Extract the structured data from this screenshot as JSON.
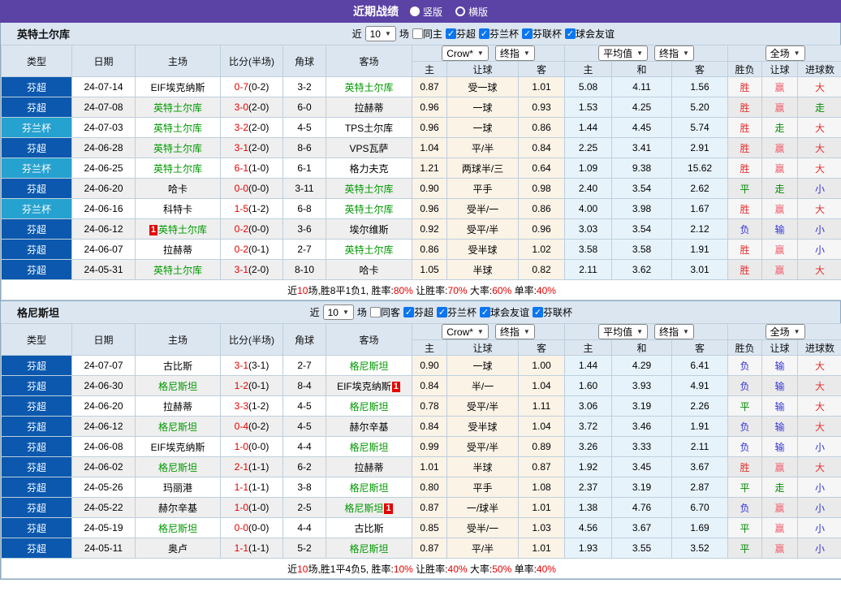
{
  "header": {
    "title": "近期战绩",
    "layout_radios": [
      {
        "label": "竖版",
        "selected": true
      },
      {
        "label": "横版",
        "selected": false
      }
    ]
  },
  "columns": {
    "left": [
      "类型",
      "日期",
      "主场",
      "比分(半场)",
      "角球",
      "客场"
    ],
    "widths": [
      87,
      78,
      105,
      77,
      53,
      106,
      43,
      88,
      57,
      58,
      74,
      69,
      42,
      44,
      55
    ],
    "dropdown_groups": [
      {
        "selects": [
          {
            "label": "Crow*",
            "name": "odds-company-select"
          },
          {
            "label": "终指",
            "name": "final-odds-select-1"
          }
        ]
      },
      {
        "selects": [
          {
            "label": "平均值",
            "name": "average-select"
          },
          {
            "label": "终指",
            "name": "final-odds-select-2"
          }
        ]
      },
      {
        "selects": [
          {
            "label": "全场",
            "name": "match-scope-select"
          }
        ]
      }
    ],
    "sub": [
      "主",
      "让球",
      "客",
      "主",
      "和",
      "客",
      "胜负",
      "让球",
      "进球数"
    ]
  },
  "colors": {
    "accent_purple": "#5b42a5",
    "league_super_blue": "#0b58ae",
    "league_cup_cyan": "#25a2d0",
    "focus_team_green": "#009900",
    "score_red": "#e60000",
    "result_red": "#e63030",
    "result_blue": "#3434d8",
    "result_green": "#008a00"
  },
  "sections": [
    {
      "team": "英特土尔库",
      "filter": {
        "near_label": "近",
        "count": "10",
        "games_label": "场",
        "same_venue": {
          "label": "同主",
          "checked": false
        },
        "leagues": [
          {
            "label": "芬超",
            "checked": true
          },
          {
            "label": "芬兰杯",
            "checked": true
          },
          {
            "label": "芬联杯",
            "checked": true
          },
          {
            "label": "球会友谊",
            "checked": true
          }
        ]
      },
      "rows": [
        {
          "league": "芬超",
          "cup": false,
          "date": "24-07-14",
          "home": "EIF埃克纳斯",
          "home_focus": false,
          "home_badge": "",
          "badge_pos": "after",
          "score": "0-7",
          "half": "(0-2)",
          "corner": "3-2",
          "away": "英特土尔库",
          "away_focus": true,
          "away_badge": "",
          "odds": [
            "0.87",
            "受一球",
            "1.01"
          ],
          "avg": [
            "5.08",
            "4.11",
            "1.56"
          ],
          "res": [
            "胜",
            "赢",
            "大"
          ],
          "res_c": [
            "red",
            "pink",
            "red"
          ]
        },
        {
          "league": "芬超",
          "cup": false,
          "date": "24-07-08",
          "home": "英特土尔库",
          "home_focus": true,
          "home_badge": "",
          "badge_pos": "after",
          "score": "3-0",
          "half": "(2-0)",
          "corner": "6-0",
          "away": "拉赫蒂",
          "away_focus": false,
          "away_badge": "",
          "odds": [
            "0.96",
            "一球",
            "0.93"
          ],
          "avg": [
            "1.53",
            "4.25",
            "5.20"
          ],
          "res": [
            "胜",
            "赢",
            "走"
          ],
          "res_c": [
            "red",
            "pink",
            "green"
          ]
        },
        {
          "league": "芬兰杯",
          "cup": true,
          "date": "24-07-03",
          "home": "英特土尔库",
          "home_focus": true,
          "home_badge": "",
          "badge_pos": "after",
          "score": "3-2",
          "half": "(2-0)",
          "corner": "4-5",
          "away": "TPS土尔库",
          "away_focus": false,
          "away_badge": "",
          "odds": [
            "0.96",
            "一球",
            "0.86"
          ],
          "avg": [
            "1.44",
            "4.45",
            "5.74"
          ],
          "res": [
            "胜",
            "走",
            "大"
          ],
          "res_c": [
            "red",
            "green",
            "red"
          ]
        },
        {
          "league": "芬超",
          "cup": false,
          "date": "24-06-28",
          "home": "英特土尔库",
          "home_focus": true,
          "home_badge": "",
          "badge_pos": "after",
          "score": "3-1",
          "half": "(2-0)",
          "corner": "8-6",
          "away": "VPS瓦萨",
          "away_focus": false,
          "away_badge": "",
          "odds": [
            "1.04",
            "平/半",
            "0.84"
          ],
          "avg": [
            "2.25",
            "3.41",
            "2.91"
          ],
          "res": [
            "胜",
            "赢",
            "大"
          ],
          "res_c": [
            "red",
            "pink",
            "red"
          ]
        },
        {
          "league": "芬兰杯",
          "cup": true,
          "date": "24-06-25",
          "home": "英特土尔库",
          "home_focus": true,
          "home_badge": "",
          "badge_pos": "after",
          "score": "6-1",
          "half": "(1-0)",
          "corner": "6-1",
          "away": "格力夫克",
          "away_focus": false,
          "away_badge": "",
          "odds": [
            "1.21",
            "两球半/三",
            "0.64"
          ],
          "avg": [
            "1.09",
            "9.38",
            "15.62"
          ],
          "res": [
            "胜",
            "赢",
            "大"
          ],
          "res_c": [
            "red",
            "pink",
            "red"
          ]
        },
        {
          "league": "芬超",
          "cup": false,
          "date": "24-06-20",
          "home": "哈卡",
          "home_focus": false,
          "home_badge": "",
          "badge_pos": "after",
          "score": "0-0",
          "half": "(0-0)",
          "corner": "3-11",
          "away": "英特土尔库",
          "away_focus": true,
          "away_badge": "",
          "odds": [
            "0.90",
            "平手",
            "0.98"
          ],
          "avg": [
            "2.40",
            "3.54",
            "2.62"
          ],
          "res": [
            "平",
            "走",
            "小"
          ],
          "res_c": [
            "green",
            "green",
            "blue"
          ]
        },
        {
          "league": "芬兰杯",
          "cup": true,
          "date": "24-06-16",
          "home": "科特卡",
          "home_focus": false,
          "home_badge": "",
          "badge_pos": "after",
          "score": "1-5",
          "half": "(1-2)",
          "corner": "6-8",
          "away": "英特土尔库",
          "away_focus": true,
          "away_badge": "",
          "odds": [
            "0.96",
            "受半/一",
            "0.86"
          ],
          "avg": [
            "4.00",
            "3.98",
            "1.67"
          ],
          "res": [
            "胜",
            "赢",
            "大"
          ],
          "res_c": [
            "red",
            "pink",
            "red"
          ]
        },
        {
          "league": "芬超",
          "cup": false,
          "date": "24-06-12",
          "home": "英特土尔库",
          "home_focus": true,
          "home_badge": "1",
          "badge_pos": "before",
          "score": "0-2",
          "half": "(0-0)",
          "corner": "3-6",
          "away": "埃尔维斯",
          "away_focus": false,
          "away_badge": "",
          "odds": [
            "0.92",
            "受平/半",
            "0.96"
          ],
          "avg": [
            "3.03",
            "3.54",
            "2.12"
          ],
          "res": [
            "负",
            "输",
            "小"
          ],
          "res_c": [
            "blue",
            "blue",
            "blue"
          ]
        },
        {
          "league": "芬超",
          "cup": false,
          "date": "24-06-07",
          "home": "拉赫蒂",
          "home_focus": false,
          "home_badge": "",
          "badge_pos": "after",
          "score": "0-2",
          "half": "(0-1)",
          "corner": "2-7",
          "away": "英特土尔库",
          "away_focus": true,
          "away_badge": "",
          "odds": [
            "0.86",
            "受半球",
            "1.02"
          ],
          "avg": [
            "3.58",
            "3.58",
            "1.91"
          ],
          "res": [
            "胜",
            "赢",
            "小"
          ],
          "res_c": [
            "red",
            "pink",
            "blue"
          ]
        },
        {
          "league": "芬超",
          "cup": false,
          "date": "24-05-31",
          "home": "英特土尔库",
          "home_focus": true,
          "home_badge": "",
          "badge_pos": "after",
          "score": "3-1",
          "half": "(2-0)",
          "corner": "8-10",
          "away": "哈卡",
          "away_focus": false,
          "away_badge": "",
          "odds": [
            "1.05",
            "半球",
            "0.82"
          ],
          "avg": [
            "2.11",
            "3.62",
            "3.01"
          ],
          "res": [
            "胜",
            "赢",
            "大"
          ],
          "res_c": [
            "red",
            "pink",
            "red"
          ]
        }
      ],
      "summary": [
        [
          "近",
          "k"
        ],
        [
          "10",
          "r"
        ],
        [
          "场,胜8平1负1, 胜率:",
          "k"
        ],
        [
          "80%",
          "r"
        ],
        [
          " 让胜率:",
          "k"
        ],
        [
          "70%",
          "r"
        ],
        [
          " 大率:",
          "k"
        ],
        [
          "60%",
          "r"
        ],
        [
          " 单率:",
          "k"
        ],
        [
          "40%",
          "r"
        ]
      ]
    },
    {
      "team": "格尼斯坦",
      "filter": {
        "near_label": "近",
        "count": "10",
        "games_label": "场",
        "same_venue": {
          "label": "同客",
          "checked": false
        },
        "leagues": [
          {
            "label": "芬超",
            "checked": true
          },
          {
            "label": "芬兰杯",
            "checked": true
          },
          {
            "label": "球会友谊",
            "checked": true
          },
          {
            "label": "芬联杯",
            "checked": true
          }
        ]
      },
      "rows": [
        {
          "league": "芬超",
          "cup": false,
          "date": "24-07-07",
          "home": "古比斯",
          "home_focus": false,
          "home_badge": "",
          "badge_pos": "after",
          "score": "3-1",
          "half": "(3-1)",
          "corner": "2-7",
          "away": "格尼斯坦",
          "away_focus": true,
          "away_badge": "",
          "odds": [
            "0.90",
            "一球",
            "1.00"
          ],
          "avg": [
            "1.44",
            "4.29",
            "6.41"
          ],
          "res": [
            "负",
            "输",
            "大"
          ],
          "res_c": [
            "blue",
            "blue",
            "red"
          ]
        },
        {
          "league": "芬超",
          "cup": false,
          "date": "24-06-30",
          "home": "格尼斯坦",
          "home_focus": true,
          "home_badge": "",
          "badge_pos": "after",
          "score": "1-2",
          "half": "(0-1)",
          "corner": "8-4",
          "away": "EIF埃克纳斯",
          "away_focus": false,
          "away_badge": "1",
          "odds": [
            "0.84",
            "半/一",
            "1.04"
          ],
          "avg": [
            "1.60",
            "3.93",
            "4.91"
          ],
          "res": [
            "负",
            "输",
            "大"
          ],
          "res_c": [
            "blue",
            "blue",
            "red"
          ]
        },
        {
          "league": "芬超",
          "cup": false,
          "date": "24-06-20",
          "home": "拉赫蒂",
          "home_focus": false,
          "home_badge": "",
          "badge_pos": "after",
          "score": "3-3",
          "half": "(1-2)",
          "corner": "4-5",
          "away": "格尼斯坦",
          "away_focus": true,
          "away_badge": "",
          "odds": [
            "0.78",
            "受平/半",
            "1.11"
          ],
          "avg": [
            "3.06",
            "3.19",
            "2.26"
          ],
          "res": [
            "平",
            "输",
            "大"
          ],
          "res_c": [
            "green",
            "blue",
            "red"
          ]
        },
        {
          "league": "芬超",
          "cup": false,
          "date": "24-06-12",
          "home": "格尼斯坦",
          "home_focus": true,
          "home_badge": "",
          "badge_pos": "after",
          "score": "0-4",
          "half": "(0-2)",
          "corner": "4-5",
          "away": "赫尔辛基",
          "away_focus": false,
          "away_badge": "",
          "odds": [
            "0.84",
            "受半球",
            "1.04"
          ],
          "avg": [
            "3.72",
            "3.46",
            "1.91"
          ],
          "res": [
            "负",
            "输",
            "大"
          ],
          "res_c": [
            "blue",
            "blue",
            "red"
          ]
        },
        {
          "league": "芬超",
          "cup": false,
          "date": "24-06-08",
          "home": "EIF埃克纳斯",
          "home_focus": false,
          "home_badge": "",
          "badge_pos": "after",
          "score": "1-0",
          "half": "(0-0)",
          "corner": "4-4",
          "away": "格尼斯坦",
          "away_focus": true,
          "away_badge": "",
          "odds": [
            "0.99",
            "受平/半",
            "0.89"
          ],
          "avg": [
            "3.26",
            "3.33",
            "2.11"
          ],
          "res": [
            "负",
            "输",
            "小"
          ],
          "res_c": [
            "blue",
            "blue",
            "blue"
          ]
        },
        {
          "league": "芬超",
          "cup": false,
          "date": "24-06-02",
          "home": "格尼斯坦",
          "home_focus": true,
          "home_badge": "",
          "badge_pos": "after",
          "score": "2-1",
          "half": "(1-1)",
          "corner": "6-2",
          "away": "拉赫蒂",
          "away_focus": false,
          "away_badge": "",
          "odds": [
            "1.01",
            "半球",
            "0.87"
          ],
          "avg": [
            "1.92",
            "3.45",
            "3.67"
          ],
          "res": [
            "胜",
            "赢",
            "大"
          ],
          "res_c": [
            "red",
            "pink",
            "red"
          ]
        },
        {
          "league": "芬超",
          "cup": false,
          "date": "24-05-26",
          "home": "玛丽港",
          "home_focus": false,
          "home_badge": "",
          "badge_pos": "after",
          "score": "1-1",
          "half": "(1-1)",
          "corner": "3-8",
          "away": "格尼斯坦",
          "away_focus": true,
          "away_badge": "",
          "odds": [
            "0.80",
            "平手",
            "1.08"
          ],
          "avg": [
            "2.37",
            "3.19",
            "2.87"
          ],
          "res": [
            "平",
            "走",
            "小"
          ],
          "res_c": [
            "green",
            "green",
            "blue"
          ]
        },
        {
          "league": "芬超",
          "cup": false,
          "date": "24-05-22",
          "home": "赫尔辛基",
          "home_focus": false,
          "home_badge": "",
          "badge_pos": "after",
          "score": "1-0",
          "half": "(1-0)",
          "corner": "2-5",
          "away": "格尼斯坦",
          "away_focus": true,
          "away_badge": "1",
          "odds": [
            "0.87",
            "一/球半",
            "1.01"
          ],
          "avg": [
            "1.38",
            "4.76",
            "6.70"
          ],
          "res": [
            "负",
            "赢",
            "小"
          ],
          "res_c": [
            "blue",
            "pink",
            "blue"
          ]
        },
        {
          "league": "芬超",
          "cup": false,
          "date": "24-05-19",
          "home": "格尼斯坦",
          "home_focus": true,
          "home_badge": "",
          "badge_pos": "after",
          "score": "0-0",
          "half": "(0-0)",
          "corner": "4-4",
          "away": "古比斯",
          "away_focus": false,
          "away_badge": "",
          "odds": [
            "0.85",
            "受半/一",
            "1.03"
          ],
          "avg": [
            "4.56",
            "3.67",
            "1.69"
          ],
          "res": [
            "平",
            "赢",
            "小"
          ],
          "res_c": [
            "green",
            "pink",
            "blue"
          ]
        },
        {
          "league": "芬超",
          "cup": false,
          "date": "24-05-11",
          "home": "奥卢",
          "home_focus": false,
          "home_badge": "",
          "badge_pos": "after",
          "score": "1-1",
          "half": "(1-1)",
          "corner": "5-2",
          "away": "格尼斯坦",
          "away_focus": true,
          "away_badge": "",
          "odds": [
            "0.87",
            "平/半",
            "1.01"
          ],
          "avg": [
            "1.93",
            "3.55",
            "3.52"
          ],
          "res": [
            "平",
            "赢",
            "小"
          ],
          "res_c": [
            "green",
            "pink",
            "blue"
          ]
        }
      ],
      "summary": [
        [
          "近",
          "k"
        ],
        [
          "10",
          "r"
        ],
        [
          "场,胜1平4负5, 胜率:",
          "k"
        ],
        [
          "10%",
          "r"
        ],
        [
          " 让胜率:",
          "k"
        ],
        [
          "40%",
          "r"
        ],
        [
          " 大率:",
          "k"
        ],
        [
          "50%",
          "r"
        ],
        [
          " 单率:",
          "k"
        ],
        [
          "40%",
          "r"
        ]
      ]
    }
  ]
}
